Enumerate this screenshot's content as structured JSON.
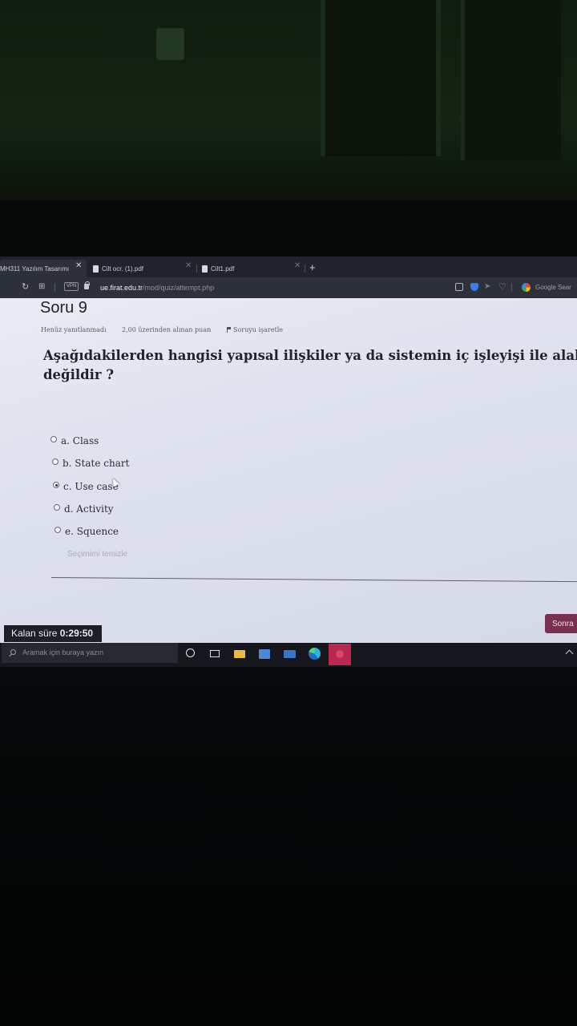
{
  "browser": {
    "tabs": [
      {
        "label": "MH311 Yazılım Tasarımı"
      },
      {
        "label": "Cilt ocr. (1).pdf"
      },
      {
        "label": "Cilt1.pdf"
      }
    ],
    "new_tab_symbol": "+",
    "vpn_badge": "VPN",
    "url_host": "ue.firat.edu.tr",
    "url_path": "/mod/quiz/attempt.php",
    "search_engine": "Google Sear"
  },
  "question": {
    "title": "Soru 9",
    "status": "Henüz yanıtlanmadı",
    "points": "2,00 üzerinden alınan puan",
    "flag_label": "Soruyu işaretle",
    "text_line1": "Aşağıdakilerden hangisi yapısal ilişkiler ya da sistemin iç işleyişi ile alakalı",
    "text_line2": "değildir ?",
    "options": [
      {
        "label": "a. Class",
        "selected": false
      },
      {
        "label": "b. State chart",
        "selected": false
      },
      {
        "label": "c. Use case",
        "selected": true
      },
      {
        "label": "d. Activity",
        "selected": false
      },
      {
        "label": "e. Squence",
        "selected": false
      }
    ],
    "clear_choice": "Seçimimi temizle"
  },
  "navigation": {
    "next_label": "Sonra"
  },
  "timer": {
    "label": "Kalan süre",
    "value": "0:29:50"
  },
  "taskbar": {
    "search_placeholder": "Aramak için buraya yazın"
  },
  "colors": {
    "next_button": "#7a2f4f",
    "page_background": "#e3e6f0",
    "taskbar": "#15171d",
    "browser_chrome": "#2c303a"
  },
  "icons": [
    "search-icon",
    "cortana-icon",
    "task-view-icon",
    "file-explorer-icon",
    "store-icon",
    "mail-icon",
    "edge-icon",
    "flag-icon",
    "lock-icon",
    "shield-icon",
    "google-icon"
  ]
}
